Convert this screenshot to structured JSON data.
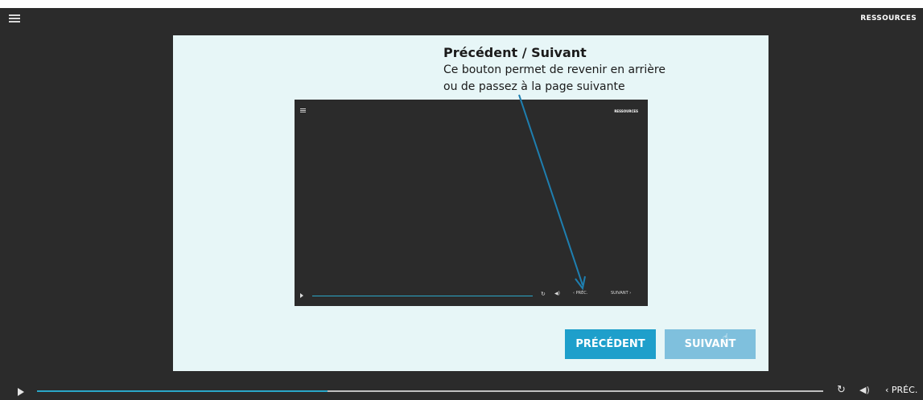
{
  "header": {
    "resources_label": "RESSOURCES"
  },
  "slide": {
    "title": "Précédent / Suivant",
    "description_line1": "Ce bouton permet de revenir en arrière",
    "description_line2": "ou de passez à la page suivante",
    "mini_player": {
      "resources_label": "RESSOURCES",
      "prev_label": "PRÉC.",
      "next_label": "SUIVANT"
    },
    "prev_button_label": "PRÉCÉDENT",
    "next_button_label": "SUIVANT"
  },
  "player": {
    "progress": 0.37,
    "prev_label": "PRÉC."
  },
  "colors": {
    "accent": "#1e9fcb",
    "accent_disabled": "#7fc0dd",
    "background": "#2b2b2b",
    "slide_background": "#e7f6f7"
  },
  "icons": [
    "menu-icon",
    "play-icon",
    "reload-icon",
    "volume-icon",
    "chevron-left-icon",
    "chevron-right-icon",
    "cursor-icon"
  ]
}
